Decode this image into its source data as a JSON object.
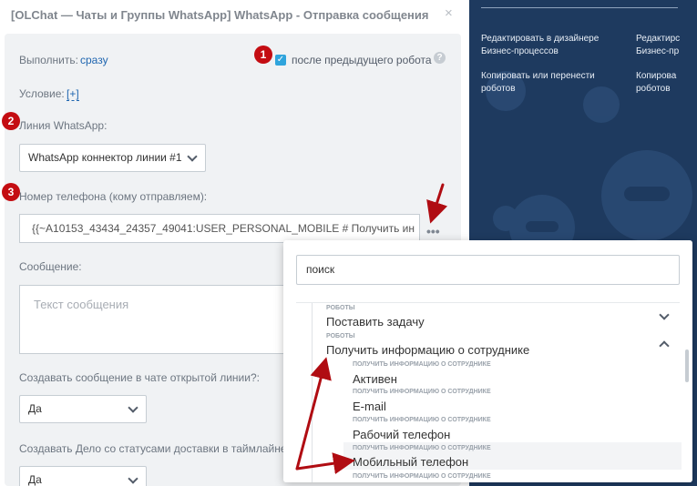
{
  "dialog": {
    "title": "[OLChat — Чаты и Группы WhatsApp] WhatsApp - Отправка сообщения",
    "close_icon": "×"
  },
  "form": {
    "execute_label": "Выполнить:",
    "execute_value": "сразу",
    "after_previous_label": "после предыдущего робота",
    "after_previous_checked": true,
    "help_icon": "?",
    "condition_label": "Условие:",
    "condition_add": "[+]",
    "line_label": "Линия WhatsApp:",
    "line_value": "WhatsApp коннектор линии #1",
    "phone_label": "Номер телефона (кому отправляем):",
    "phone_value": "{{~A10153_43434_24357_49041:USER_PERSONAL_MOBILE # Получить ин",
    "dots": "•••",
    "message_label": "Сообщение:",
    "message_placeholder": "Текст сообщения",
    "create_in_chat_label": "Создавать сообщение в чате открытой линии?:",
    "create_in_chat_value": "Да",
    "create_task_label": "Создавать Дело со статусами доставки в таймлайне?:",
    "create_task_value": "Да"
  },
  "badges": [
    "1",
    "2",
    "3"
  ],
  "right_panel": {
    "link1": "Редактировать в дизайнере Бизнес-процессов",
    "link1_clip": "Редактирс Бизнес-пр",
    "link2": "Копировать или перенести роботов",
    "link2_clip": "Копирова роботов"
  },
  "popup": {
    "search_value": "поиск",
    "rows": [
      {
        "category": "РОБОТЫ",
        "label": "Поставить задачу",
        "expanded": false
      },
      {
        "category": "РОБОТЫ",
        "label": "Получить информацию о сотруднике",
        "expanded": true
      },
      {
        "category": "ПОЛУЧИТЬ ИНФОРМАЦИЮ О СОТРУДНИКЕ",
        "label": "Активен"
      },
      {
        "category": "ПОЛУЧИТЬ ИНФОРМАЦИЮ О СОТРУДНИКЕ",
        "label": "E-mail"
      },
      {
        "category": "ПОЛУЧИТЬ ИНФОРМАЦИЮ О СОТРУДНИКЕ",
        "label": "Рабочий телефон"
      },
      {
        "category": "ПОЛУЧИТЬ ИНФОРМАЦИЮ О СОТРУДНИКЕ",
        "label": "Мобильный телефон"
      },
      {
        "category": "ПОЛУЧИТЬ ИНФОРМАЦИЮ О СОТРУДНИКЕ",
        "label": ""
      }
    ]
  },
  "colors": {
    "accent": "#2fa4dc",
    "link": "#2066b0",
    "badge": "#c40d12",
    "arrow": "#b00c12",
    "right_bg": "#1e3a5f"
  }
}
